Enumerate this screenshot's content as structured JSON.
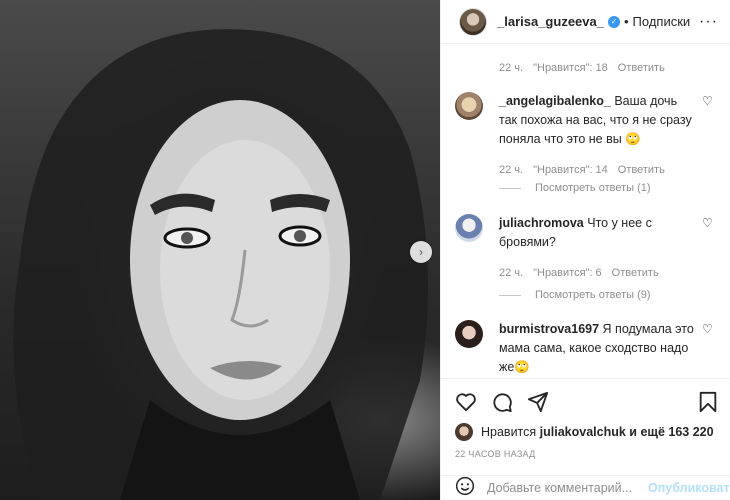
{
  "post": {
    "author": "_larisa_guzeeva_",
    "verified_mark": "✓",
    "separator": "•",
    "follow_label": "Подписки",
    "more_label": "···"
  },
  "photo": {
    "next_arrow": "›"
  },
  "top_comment_meta": {
    "time": "22 ч.",
    "likes": "\"Нравится\": 18",
    "reply": "Ответить"
  },
  "comments": [
    {
      "user": "_angelagibalenko_",
      "text": "Ваша дочь так похожа на вас, что я не сразу поняла что это не вы 🙄",
      "time": "22 ч.",
      "likes": "\"Нравится\": 14",
      "reply": "Ответить",
      "view_replies": "Посмотреть ответы (1)"
    },
    {
      "user": "juliachromova",
      "text": "Что у нее с бровями?",
      "time": "22 ч.",
      "likes": "\"Нравится\": 6",
      "reply": "Ответить",
      "view_replies": "Посмотреть ответы (9)"
    },
    {
      "user": "burmistrova1697",
      "text": "Я подумала это мама сама, какое сходство надо же🙄",
      "time": "",
      "likes": "",
      "reply": "",
      "view_replies": ""
    }
  ],
  "likes": {
    "prefix": "Нравится",
    "user": "juliakovalchuk",
    "suffix": "и ещё 163 220"
  },
  "posted_time": "22 часов назад",
  "add_comment": {
    "placeholder": "Добавьте комментарий...",
    "publish_label": "Опубликовать"
  },
  "icons": {
    "emoji": "smiley-icon",
    "like": "heart-icon",
    "comment": "comment-icon",
    "share": "share-icon",
    "save": "bookmark-icon"
  }
}
